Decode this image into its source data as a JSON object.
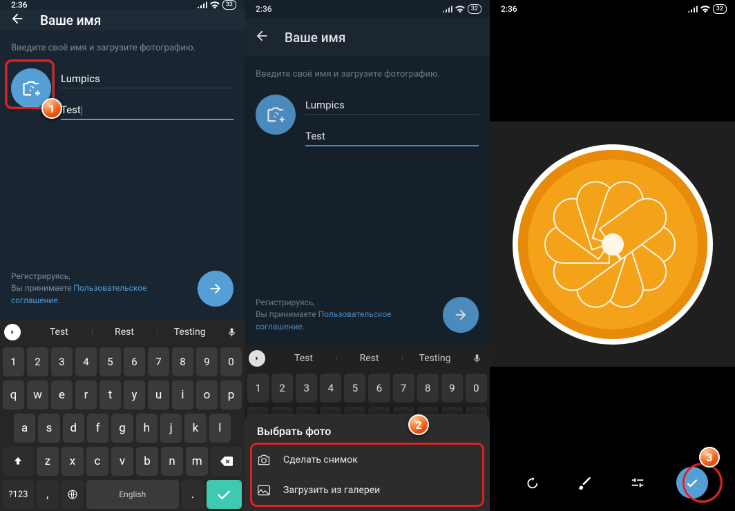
{
  "status": {
    "time": "2:36",
    "battery": "32"
  },
  "header": {
    "title": "Ваше имя"
  },
  "form": {
    "hint": "Введите своё имя и загрузите фотографию.",
    "first": "Lumpics",
    "last": "Test",
    "terms_pre": "Регистрируясь,\nВы принимаете ",
    "terms_link": "Пользовательское соглашение",
    "terms_post": "."
  },
  "kb": {
    "sug": [
      "Test",
      "Rest",
      "Testing"
    ],
    "row1": [
      "1",
      "2",
      "3",
      "4",
      "5",
      "6",
      "7",
      "8",
      "9",
      "0"
    ],
    "row2": [
      "q",
      "w",
      "e",
      "r",
      "t",
      "y",
      "u",
      "i",
      "o",
      "p"
    ],
    "row3": [
      "a",
      "s",
      "d",
      "f",
      "g",
      "h",
      "j",
      "k",
      "l"
    ],
    "row4_mid": [
      "z",
      "x",
      "c",
      "v",
      "b",
      "n",
      "m"
    ],
    "sym": "?123",
    "lang": "English"
  },
  "sheet": {
    "title": "Выбрать фото",
    "opt_camera": "Сделать снимок",
    "opt_gallery": "Загрузить из галереи"
  },
  "markers": {
    "m1": "1",
    "m2": "2",
    "m3": "3"
  }
}
